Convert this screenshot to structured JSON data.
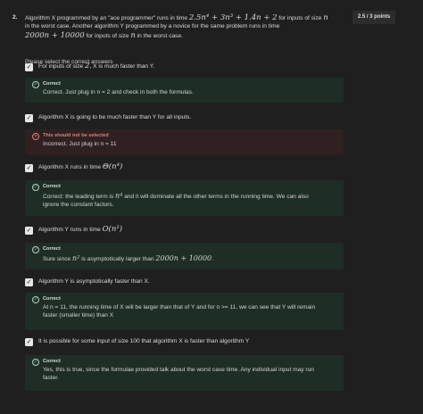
{
  "question": {
    "number": "2.",
    "points": "2.5 / 3 points",
    "prompt": {
      "l1_a": "Algorithm  X programmed by an \"ace programmer\" runs in time ",
      "l1_math": "2.5n⁴ + 3n³ + 1.4n + 2",
      "l1_b": " for inputs of size ",
      "l1_n": "n",
      "l2": "in the worst case. Another algorithm Y programmed by a novice for the same problem runs in time",
      "l3_math": "2000n + 10000",
      "l3_b": " for inputs of size ",
      "l3_n": "n",
      "l3_c": " in the worst case."
    },
    "instruction": "Please select the correct answers"
  },
  "options": [
    {
      "text_a": "For inputs of size ",
      "text_math": "2",
      "text_b": ", X is much faster than Y.",
      "feedback_status": "Correct",
      "feedback_text": "Correct.  Just plug in n = 2 and check in both the formulas."
    },
    {
      "text": "Algorithm X is going to be much faster than Y for all inputs.",
      "feedback_status": "This should not be selected",
      "feedback_text": "Incorrect.  Just plug in n = 11"
    },
    {
      "text_a": "Algorithm X runs in time ",
      "text_math": "Θ(n⁴)",
      "feedback_status": "Correct",
      "feedback_a": "Correct: the leading term is ",
      "feedback_math": "n⁴",
      "feedback_b": " and it will dominate all the other terms in the running time. We can also",
      "feedback_c": "ignore the constant factors."
    },
    {
      "text_a": "Algorithm Y runs in time ",
      "text_math": "O(n²)",
      "feedback_status": "Correct",
      "feedback_a": "Sure since ",
      "feedback_math1": "n²",
      "feedback_b": " is asymptotically larger than ",
      "feedback_math2": "2000n + 10000",
      "feedback_c": "."
    },
    {
      "text": "Algorithm Y is asymptotically faster than X.",
      "feedback_status": "Correct",
      "feedback_l1": "At n = 11, the running time of X will be larger than that of Y and for n >= 11, we can see that Y will remain",
      "feedback_l2": "faster (smaller time) than X"
    },
    {
      "text": "It is possible for some input of size 100 that algorithm X is faster than algorithm Y",
      "feedback_status": "Correct",
      "feedback_l1": "Yes, this is true, since the formulae provided talk about the worst case time. Any individual input may run",
      "feedback_l2": "faster."
    }
  ],
  "icons": {
    "checkbox": "checkmark-icon",
    "correct": "check-circle-icon",
    "incorrect": "x-circle-icon"
  },
  "colors": {
    "background": "#1f1f1f",
    "correct_bg": "#1e2d26",
    "incorrect_bg": "#2f2121",
    "incorrect_text": "#e07e7e"
  }
}
